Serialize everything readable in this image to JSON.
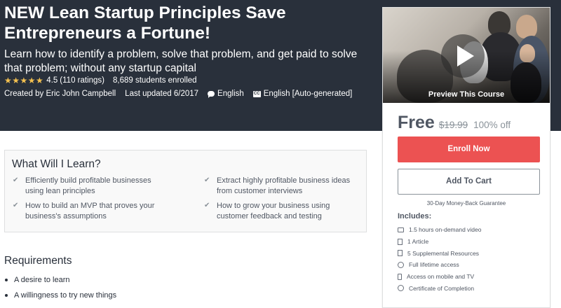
{
  "course": {
    "title": "NEW Lean Startup Principles Save Entrepreneurs a Fortune!",
    "subtitle": "Learn how to identify a problem, solve that problem, and get paid to solve that problem; without any startup capital",
    "stars": "★★★★★",
    "rating": "4.5",
    "ratings_count": "(110 ratings)",
    "enrolled": "8,689 students enrolled",
    "created_by": "Created by Eric John Campbell",
    "updated": "Last updated 6/2017",
    "language": "English",
    "captions": "English [Auto-generated]",
    "captions_icon_text": "CC"
  },
  "sidebar": {
    "preview_label": "Preview This Course",
    "price": "Free",
    "original_price": "$19.99",
    "discount": "100% off",
    "enroll_label": "Enroll Now",
    "cart_label": "Add To Cart",
    "guarantee": "30-Day Money-Back Guarantee",
    "includes_title": "Includes:",
    "includes": [
      {
        "icon": "video-icon",
        "text": "1.5 hours on-demand video"
      },
      {
        "icon": "article-icon",
        "text": "1 Article"
      },
      {
        "icon": "file-icon",
        "text": "5 Supplemental Resources"
      },
      {
        "icon": "infinity-icon",
        "text": "Full lifetime access"
      },
      {
        "icon": "mobile-icon",
        "text": "Access on mobile and TV"
      },
      {
        "icon": "certificate-icon",
        "text": "Certificate of Completion"
      }
    ]
  },
  "learn": {
    "title": "What Will I Learn?",
    "items": [
      "Efficiently build profitable businesses using lean principles",
      "Extract highly profitable business ideas from customer interviews",
      "How to build an MVP that proves your business's assumptions",
      "How to grow your business using customer feedback and testing"
    ]
  },
  "requirements": {
    "title": "Requirements",
    "items": [
      "A desire to learn",
      "A willingness to try new things"
    ]
  },
  "colors": {
    "header_bg": "#29303b",
    "star": "#f4c150",
    "enroll": "#ec5252"
  }
}
